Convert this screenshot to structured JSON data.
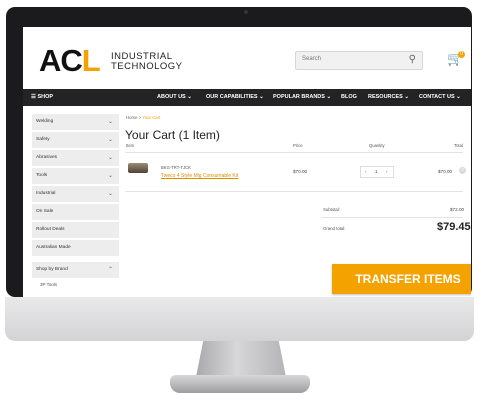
{
  "header": {
    "logo_main": "ACL",
    "logo_line1": "INDUSTRIAL",
    "logo_line2": "TECHNOLOGY",
    "search_placeholder": "Search",
    "cart_count": "0"
  },
  "nav": {
    "shop_label": "SHOP",
    "items": [
      "ABOUT US",
      "OUR CAPABILITIES",
      "POPULAR BRANDS",
      "BLOG",
      "RESOURCES",
      "CONTACT US"
    ]
  },
  "sidebar": {
    "items": [
      "Welding",
      "Safety",
      "Abrasives",
      "Tools",
      "Industrial",
      "On Sale",
      "Rollout Deals",
      "Australian Made",
      "Shop by Brand"
    ],
    "sub_items": [
      "3P Tools"
    ]
  },
  "cart": {
    "breadcrumb_home": "Home",
    "breadcrumb_current": "Your Cart",
    "title": "Your Cart (1 Item)",
    "col_item": "Item",
    "col_price": "Price",
    "col_quantity": "Quantity",
    "col_total": "Total",
    "item_sku": "BKG-TRT-TJCK",
    "item_name": "Tweco 4 Style Mig Consumable Kit",
    "item_price": "$70.00",
    "item_qty": "1",
    "item_total": "$70.00",
    "subtotal_label": "Subtotal:",
    "subtotal_value": "$72.00",
    "grand_total_label": "Grand total:",
    "grand_total_value": "$79.45",
    "transfer_button": "TRANSFER ITEMS"
  },
  "colors": {
    "accent": "#f4a200",
    "nav_bg": "#232326",
    "bezel": "#1b1b1d"
  }
}
